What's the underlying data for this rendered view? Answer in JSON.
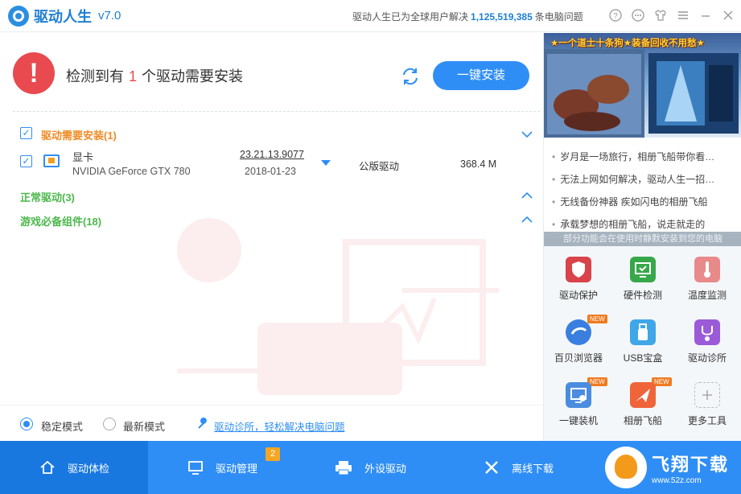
{
  "titlebar": {
    "app_name": "驱动人生",
    "version": "v7.0",
    "notice_prefix": "驱动人生已为全球用户解决",
    "notice_count": "1,125,519,385",
    "notice_suffix": "条电脑问题",
    "icons": [
      "help-icon",
      "chat-icon",
      "skin-icon",
      "menu-icon",
      "minimize-icon",
      "close-icon"
    ]
  },
  "status": {
    "prefix": "检测到有",
    "count": "1",
    "suffix": "个驱动需要安装",
    "install_button": "一键安装"
  },
  "sections": {
    "need_install": "驱动需要安装(1)",
    "normal": "正常驱动(3)",
    "game_components": "游戏必备组件(18)"
  },
  "driver": {
    "category": "显卡",
    "model": "NVIDIA GeForce GTX 780",
    "version": "23.21.13.9077",
    "date": "2018-01-23",
    "type": "公版驱动",
    "size": "368.4 M"
  },
  "bottom": {
    "stable_mode": "稳定模式",
    "latest_mode": "最新模式",
    "diag_link": "驱动诊所，轻松解决电脑问题"
  },
  "sidebar": {
    "banner_title": "★一个道士十条狗★装备回收不用愁★",
    "news": [
      "岁月是一场旅行，相册飞船带你看…",
      "无法上网如何解决，驱动人生一招…",
      "无线备份神器 疾如闪电的相册飞船",
      "承载梦想的相册飞船，说走就走的"
    ],
    "notice": "部分功能会在使用时静默安装到您的电脑",
    "tools": [
      {
        "label": "驱动保护",
        "icon": "shield-icon",
        "color": "#d9434a",
        "new": ""
      },
      {
        "label": "硬件检测",
        "icon": "monitor-check-icon",
        "color": "#37a84a",
        "new": ""
      },
      {
        "label": "温度监测",
        "icon": "thermometer-icon",
        "color": "#e88a8a",
        "new": ""
      },
      {
        "label": "百贝浏览器",
        "icon": "browser-icon",
        "color": "#3a7fe0",
        "new": "NEW"
      },
      {
        "label": "USB宝盒",
        "icon": "usb-icon",
        "color": "#3fa6e8",
        "new": ""
      },
      {
        "label": "驱动诊所",
        "icon": "stethoscope-icon",
        "color": "#9b5bd8",
        "new": ""
      },
      {
        "label": "一键装机",
        "icon": "install-pc-icon",
        "color": "#4a8de0",
        "new": "NEW"
      },
      {
        "label": "相册飞船",
        "icon": "airship-icon",
        "color": "#f0643a",
        "new": "NEW"
      },
      {
        "label": "更多工具",
        "icon": "plus-icon",
        "color": "#cccccc",
        "new": ""
      }
    ]
  },
  "nav": {
    "items": [
      {
        "label": "驱动体检",
        "icon": "home-icon"
      },
      {
        "label": "驱动管理",
        "icon": "monitor-icon",
        "badge": "2"
      },
      {
        "label": "外设驱动",
        "icon": "printer-icon"
      },
      {
        "label": "离线下载",
        "icon": "tools-icon"
      }
    ],
    "brand_name": "飞翔下载",
    "brand_url": "www.52z.com"
  },
  "colors": {
    "primary": "#2f8ef5",
    "alert": "#e84a4f",
    "warning_section": "#f08a24",
    "ok_section": "#4cb84c"
  }
}
